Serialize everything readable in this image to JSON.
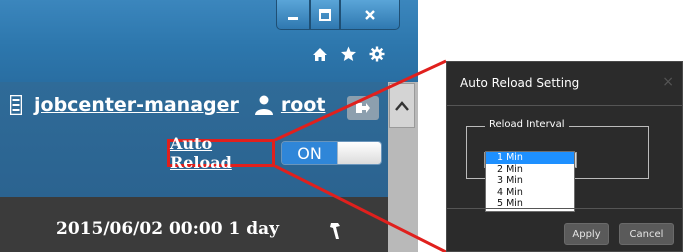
{
  "header": {
    "user_group": "jobcenter-manager",
    "user_name": "root",
    "auto_reload_label": "Auto Reload",
    "auto_reload_state": "ON"
  },
  "date_bar": {
    "text": "2015/06/02 00:00 1 day"
  },
  "dialog": {
    "title": "Auto Reload Setting",
    "close_glyph": "×",
    "fieldset_label": "Reload Interval",
    "options": [
      "1 Min",
      "2 Min",
      "3 Min",
      "4 Min",
      "5 Min"
    ],
    "selected_option": "1 Min",
    "apply_label": "Apply",
    "cancel_label": "Cancel"
  },
  "colors": {
    "titlebar": "#2d77ad",
    "callout": "#e0201d",
    "toggle_on": "#2f86d8",
    "dialog_bg": "#2b2b2b",
    "selected_option": "#1e90ff"
  },
  "icons": [
    "minimize-icon",
    "maximize-icon",
    "close-icon",
    "home-icon",
    "star-icon",
    "gear-icon",
    "server-icon",
    "user-icon",
    "logout-icon",
    "scroll-up-arrow-icon",
    "wrench-icon"
  ]
}
